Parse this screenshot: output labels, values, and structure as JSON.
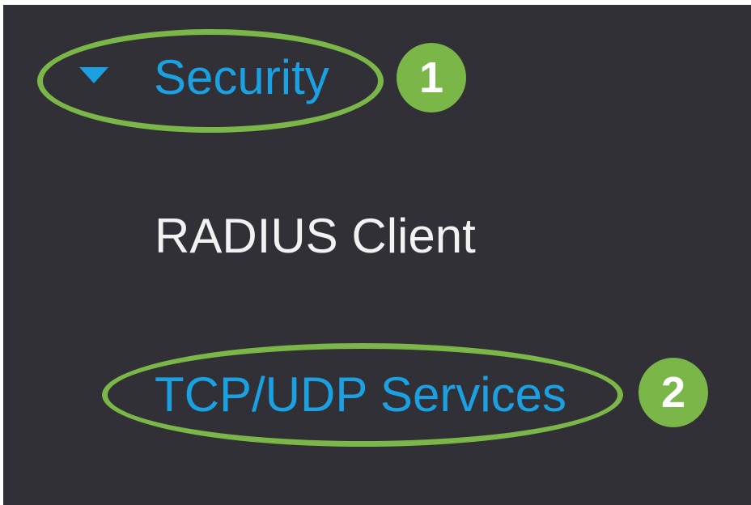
{
  "nav": {
    "security": {
      "label": "Security",
      "expanded": true,
      "icon": "caret-down-icon"
    },
    "items": [
      {
        "label": "RADIUS Client"
      },
      {
        "label": "TCP/UDP Services"
      }
    ]
  },
  "annotations": {
    "step1": "1",
    "step2": "2"
  },
  "colors": {
    "background": "#313036",
    "accent_link": "#1ba0e2",
    "text_default": "#f2f2f2",
    "highlight": "#7ab648"
  }
}
